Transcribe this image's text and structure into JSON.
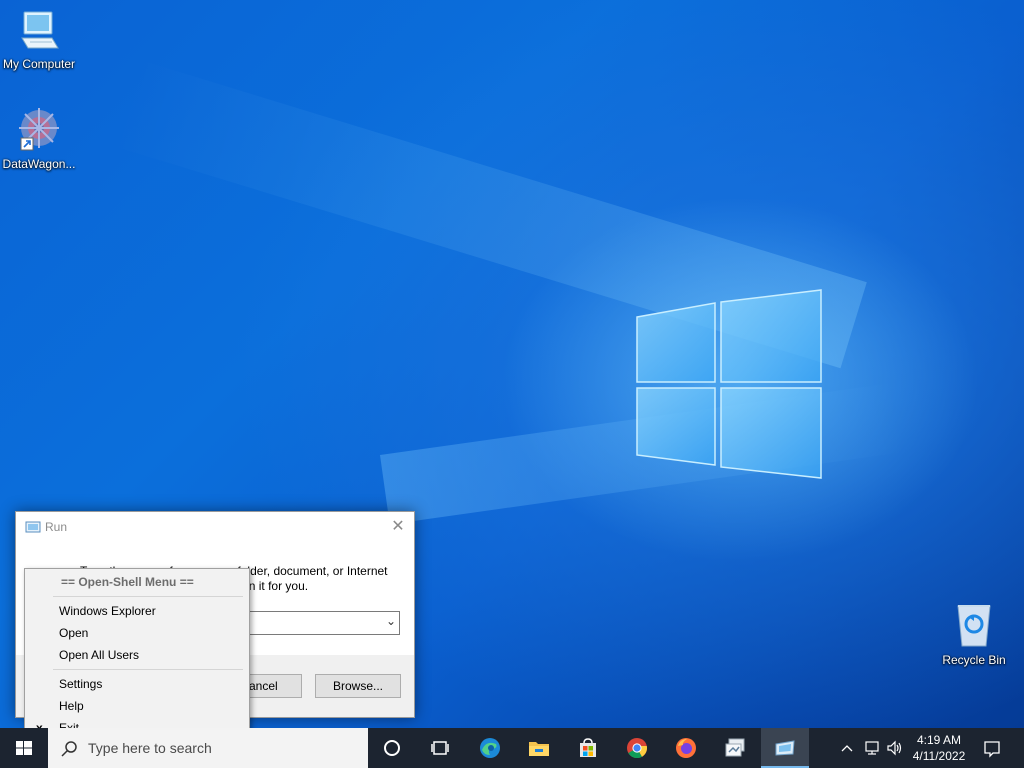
{
  "desktop": {
    "icons": [
      {
        "label": "My Computer",
        "icon": "computer-icon"
      },
      {
        "label": "DataWagon...",
        "icon": "datawagon-icon"
      },
      {
        "label": "Recycle Bin",
        "icon": "recycle-bin-icon"
      }
    ]
  },
  "run_dialog": {
    "title": "Run",
    "description": "Type the name of a program, folder, document, or Internet resource, and Windows will open it for you.",
    "open_value": "",
    "cancel_label": "Cancel",
    "browse_label": "Browse..."
  },
  "context_menu": {
    "header": "== Open-Shell Menu ==",
    "items": [
      "Windows Explorer",
      "Open",
      "Open All Users",
      "Settings",
      "Help",
      "Exit"
    ],
    "exit_marker": "x"
  },
  "taskbar": {
    "search_placeholder": "Type here to search",
    "apps": [
      "cortana-icon",
      "task-view-icon",
      "edge-icon",
      "file-explorer-icon",
      "store-icon",
      "chrome-icon",
      "firefox-icon",
      "remote-app-icon",
      "run-icon"
    ],
    "time": "4:19 AM",
    "date": "4/11/2022",
    "tray": [
      "chevron-up-icon",
      "network-icon",
      "volume-icon",
      "notification-icon"
    ]
  },
  "colors": {
    "desktop_blue": "#0a63d4",
    "taskbar_bg": "#1c2430",
    "accent": "#0078d7"
  }
}
